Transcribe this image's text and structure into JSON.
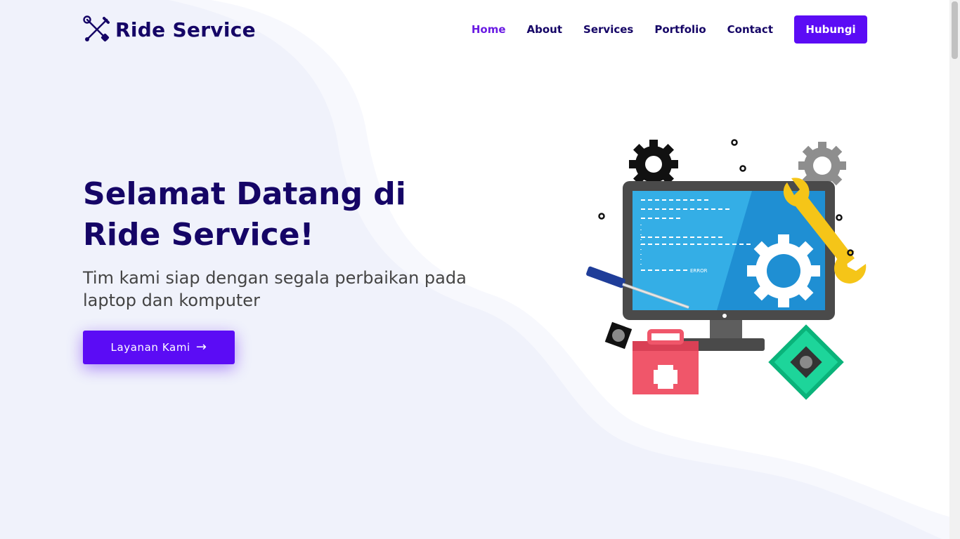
{
  "brand": {
    "name": "Ride Service",
    "icon": "tools-icon"
  },
  "nav": {
    "items": [
      {
        "label": "Home",
        "active": true
      },
      {
        "label": "About"
      },
      {
        "label": "Services"
      },
      {
        "label": "Portfolio"
      },
      {
        "label": "Contact"
      }
    ],
    "cta_label": "Hubungi"
  },
  "hero": {
    "title": "Selamat Datang di Ride Service!",
    "subtitle": "Tim kami siap dengan segala perbaikan pada laptop dan komputer",
    "button_label": "Layanan Kami",
    "button_icon": "arrow-right-icon"
  },
  "illustration": {
    "screen_error_text": "ERROR",
    "icon": "computer-repair-illustration"
  },
  "colors": {
    "primary": "#5b0cf5",
    "heading": "#150566",
    "nav_active": "#6a1be3",
    "background_wave": "#f2f3fb"
  }
}
